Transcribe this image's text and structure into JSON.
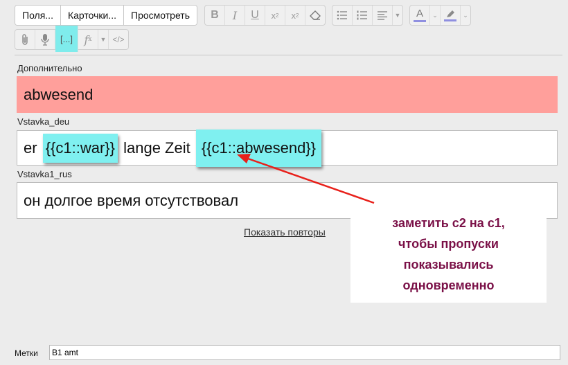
{
  "toolbar": {
    "fields_label": "Поля...",
    "cards_label": "Карточки...",
    "preview_label": "Просмотреть"
  },
  "fields": [
    {
      "label": "Дополнительно",
      "value": "abwesend"
    },
    {
      "label": "Vstavka_deu",
      "text_before": "er ",
      "cloze1": "{{c1::war}}",
      "text_middle": " lange Zeit ",
      "cloze2": "{{c1::abwesend}}"
    },
    {
      "label": "Vstavka1_rus",
      "value": "он долгое время отсутствовал"
    }
  ],
  "show_repeats_link": "Показать повторы",
  "annotation": {
    "lines": [
      "заметить с2 на с1,",
      "чтобы пропуски",
      "показывались",
      "одновременно"
    ],
    "color": "#7a1047",
    "arrow_color": "#e8201a"
  },
  "tags": {
    "label": "Метки",
    "value": "B1 amt"
  },
  "colors": {
    "highlight": "#7ff0f0",
    "field_marked": "#ff9f9b",
    "text_color_bar": "#8f8fe0"
  }
}
